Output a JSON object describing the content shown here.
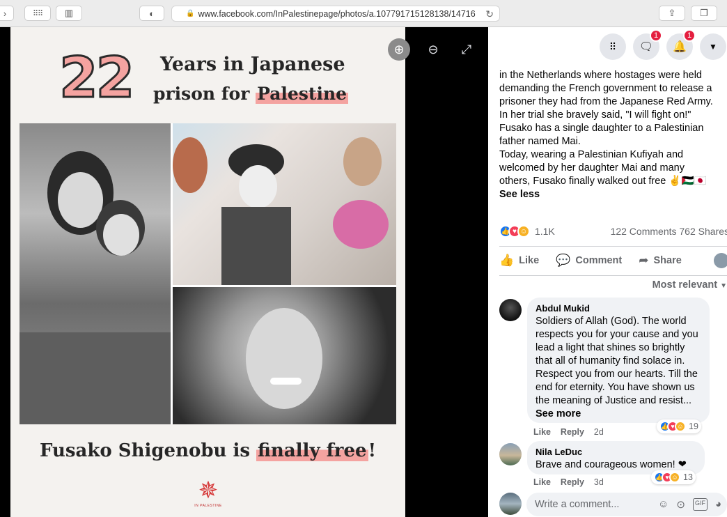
{
  "browser": {
    "url": "www.facebook.com/InPalestinepage/photos/a.107791715128138/14716"
  },
  "photo": {
    "number": "22",
    "title_line1": "Years in Japanese",
    "title_line2_prefix": "prison for ",
    "title_line2_highlight": "Palestine",
    "bottom_prefix": "Fusako Shigenobu is ",
    "bottom_highlight": "finally free",
    "bottom_suffix": "!",
    "logo_text": "IN PALESTINE"
  },
  "nav": {
    "messenger_badge": "1",
    "notifications_badge": "1"
  },
  "post": {
    "text": "in the Netherlands where hostages were held\ndemanding the French government to release a\nprisoner they had from the Japanese Red Army.\nIn her trial she bravely said, \"I will fight on!\"\nFusako has a single daughter to a Palestinian\nfather named Mai.\nToday, wearing a Palestinian Kufiyah and\nwelcomed by her daughter Mai and many\nothers, Fusako finally walked out free ✌🇵🇸🇯🇵",
    "see_less": "See less",
    "reaction_count": "1.1K",
    "stats": "122 Comments  762 Shares"
  },
  "actions": {
    "like": "Like",
    "comment": "Comment",
    "share": "Share"
  },
  "sort": "Most relevant",
  "comments": [
    {
      "name": "Abdul Mukid",
      "text": "Soldiers of Allah (God). The world respects you for your cause and you lead a light that shines so brightly that all of humanity find solace in. Respect you from our hearts. Till the end for eternity. You have shown us the meaning of Justice and resist... ",
      "see_more": "See more",
      "like": "Like",
      "reply": "Reply",
      "time": "2d",
      "reactions": "19"
    },
    {
      "name": "Nila LeDuc",
      "text": "Brave and courageous women! ❤",
      "like": "Like",
      "reply": "Reply",
      "time": "3d",
      "reactions": "13"
    }
  ],
  "write_comment": {
    "placeholder": "Write a comment..."
  },
  "colors": {
    "accent_pink": "#f4a3a0",
    "facebook_blue": "#1877f2",
    "badge_red": "#e41e3f"
  }
}
